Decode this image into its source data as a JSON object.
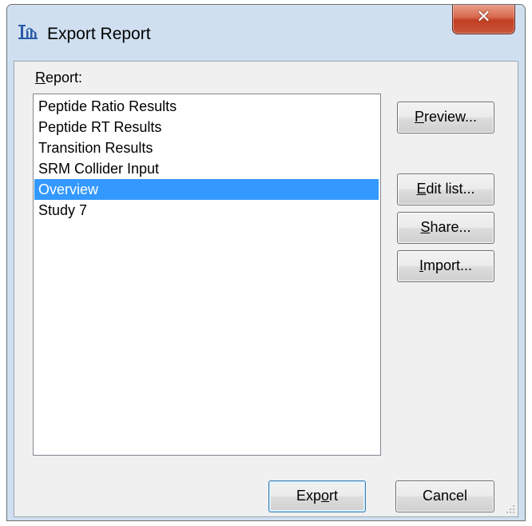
{
  "window": {
    "title": "Export Report",
    "app_icon": "skyline-app-icon",
    "close_glyph": "✕"
  },
  "report": {
    "label_mnemonic": "R",
    "label_rest": "eport:",
    "items": [
      {
        "label": "Peptide Ratio Results",
        "selected": false
      },
      {
        "label": "Peptide RT Results",
        "selected": false
      },
      {
        "label": "Transition Results",
        "selected": false
      },
      {
        "label": "SRM Collider Input",
        "selected": false
      },
      {
        "label": "Overview",
        "selected": true
      },
      {
        "label": "Study 7",
        "selected": false
      }
    ]
  },
  "buttons": {
    "preview": {
      "mn": "P",
      "rest": "review..."
    },
    "edit_list": {
      "mn": "E",
      "rest": "dit list..."
    },
    "share": {
      "mn": "S",
      "rest": "hare..."
    },
    "import": {
      "mn": "I",
      "rest": "mport..."
    },
    "export": {
      "pre": "Exp",
      "mn": "o",
      "rest": "rt"
    },
    "cancel": {
      "label": "Cancel"
    }
  },
  "colors": {
    "selection": "#3399ff",
    "close_button": "#c8553a",
    "title_bar": "#cfdff0",
    "dialog_face": "#f0f0f0"
  }
}
